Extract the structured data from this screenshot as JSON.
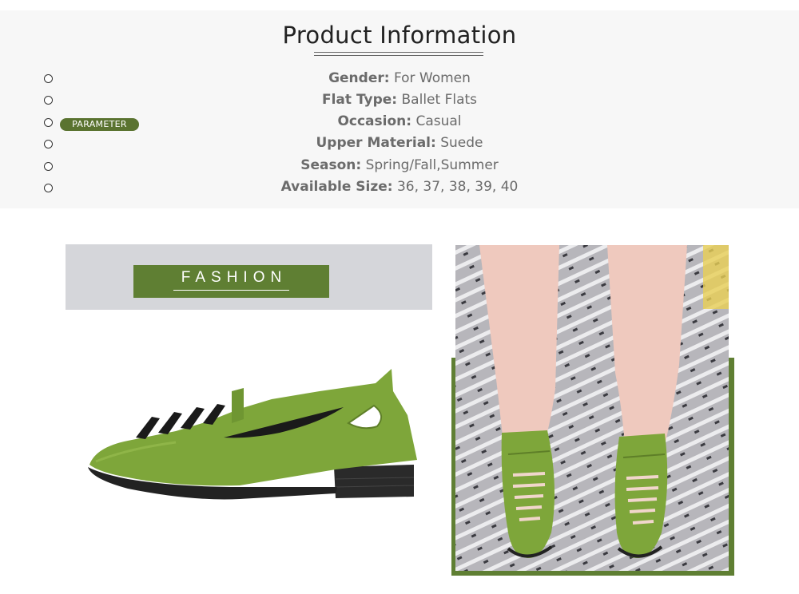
{
  "info": {
    "title": "Product Information",
    "badge": "PARAMETER",
    "specs": [
      {
        "label": "Gender:",
        "value": "For Women"
      },
      {
        "label": "Flat Type:",
        "value": "Ballet Flats"
      },
      {
        "label": "Occasion:",
        "value": "Casual"
      },
      {
        "label": "Upper Material:",
        "value": "Suede"
      },
      {
        "label": "Season:",
        "value": "Spring/Fall,Summer"
      },
      {
        "label": "Available Size:",
        "value": "36, 37, 38, 39, 40"
      }
    ]
  },
  "fashion": {
    "label": "FASHION"
  },
  "colors": {
    "accent": "#5f7f33",
    "panel": "#f7f7f7",
    "shoe": "#7ea63a"
  }
}
